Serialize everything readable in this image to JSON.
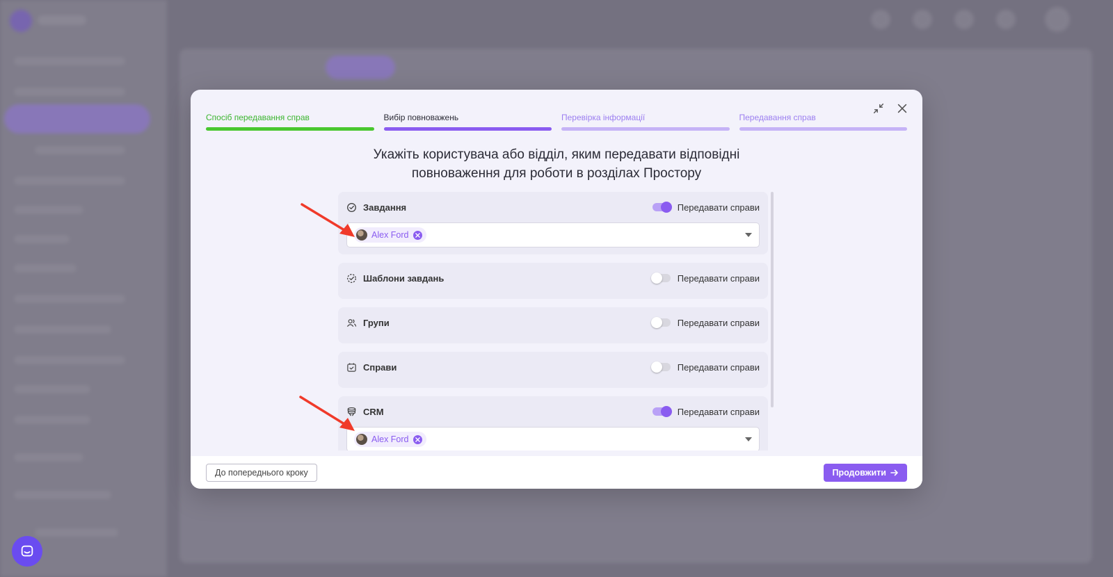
{
  "modal": {
    "steps": [
      {
        "label": "Спосіб передавання справ",
        "state": "done"
      },
      {
        "label": "Вибір повноважень",
        "state": "active"
      },
      {
        "label": "Перевірка інформації",
        "state": "todo"
      },
      {
        "label": "Передавання справ",
        "state": "todo"
      }
    ],
    "heading_line1": "Укажіть користувача або відділ, яким передавати відповідні",
    "heading_line2": "повноваження для роботи в розділах Простору",
    "sections": [
      {
        "title": "Завдання",
        "icon": "check-circle-icon",
        "toggle_label": "Передавати справи",
        "enabled": true,
        "assignee": "Alex Ford"
      },
      {
        "title": "Шаблони завдань",
        "icon": "dashed-check-circle-icon",
        "toggle_label": "Передавати справи",
        "enabled": false
      },
      {
        "title": "Групи",
        "icon": "users-icon",
        "toggle_label": "Передавати справи",
        "enabled": false
      },
      {
        "title": "Справи",
        "icon": "calendar-check-icon",
        "toggle_label": "Передавати справи",
        "enabled": false
      },
      {
        "title": "CRM",
        "icon": "database-icon",
        "toggle_label": "Передавати справи",
        "enabled": true,
        "assignee": "Alex Ford"
      }
    ],
    "footer": {
      "back_label": "До попереднього кроку",
      "next_label": "Продовжити"
    }
  },
  "colors": {
    "accent": "#8a5cf0",
    "done": "#49c72f",
    "todo": "#c5b3f6",
    "arrow": "#f03a2a"
  }
}
